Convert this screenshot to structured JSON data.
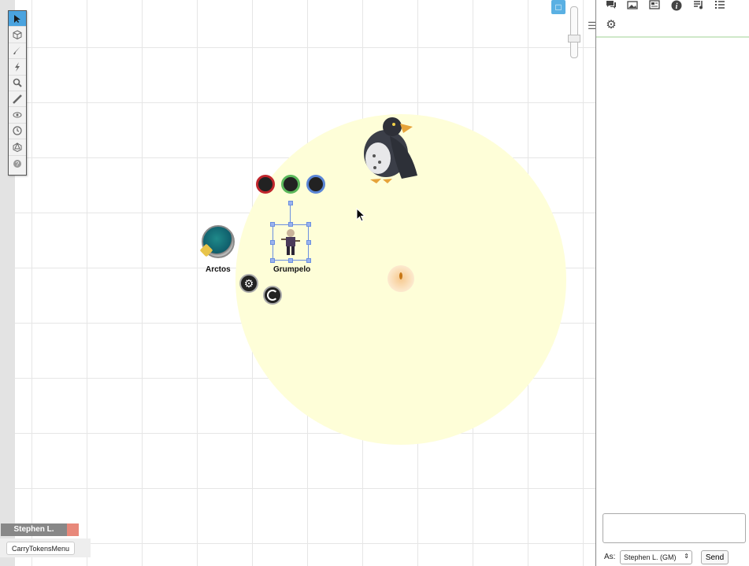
{
  "canvas": {
    "tokens": [
      {
        "name": "Arctos"
      },
      {
        "name": "Grumpelo"
      }
    ]
  },
  "token_bars": [
    {
      "color": "#c0262c"
    },
    {
      "color": "#5cb85c"
    },
    {
      "color": "#5b86d6"
    }
  ],
  "radial_menu": {
    "settings_icon": "gear-icon",
    "layer_icon": "spiral-icon"
  },
  "toolbar": {
    "tools": [
      "select-tool",
      "object-tool",
      "draw-tool",
      "fx-tool",
      "zoom-tool",
      "measure-tool",
      "fog-tool",
      "turn-tracker-tool",
      "dice-tool",
      "help-tool"
    ]
  },
  "sidebar": {
    "tabs": [
      "chat-icon",
      "art-library-icon",
      "journal-icon",
      "compendium-icon",
      "jukebox-icon",
      "collection-icon",
      "settings-icon"
    ],
    "chat": {
      "as_label": "As:",
      "as_value": "Stephen L. (GM)",
      "send_label": "Send"
    }
  },
  "player": {
    "name": "Stephen L.",
    "color": "#e8887a"
  },
  "macro": {
    "label": "CarryTokensMenu"
  }
}
